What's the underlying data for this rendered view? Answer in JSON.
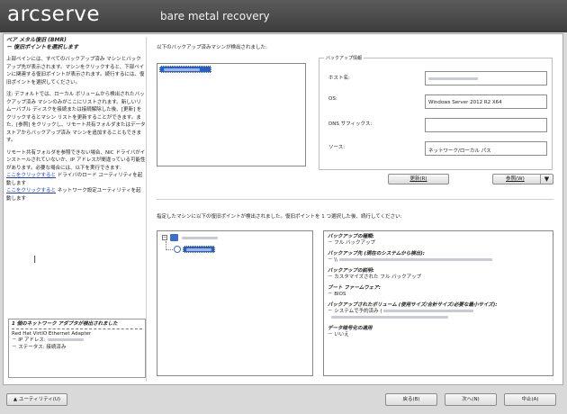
{
  "header": {
    "logo": "arcserve",
    "title": "bare metal recovery"
  },
  "left": {
    "title_line1": "ベア メタル復旧 (BMR)",
    "title_line2": "－ 復旧ポイントを選択します",
    "p1": "上部ペインには、すべてのバックアップ済み マシンとバックアップ先が表示されます。マシンをクリックすると、下部ペインに関連する復旧ポイントが表示されます。続行するには、復旧ポイントを選択してください。",
    "p2": "注: デフォルトでは、ローカル ボリュームから検出されたバックアップ済み マシンのみがここにリストされます。新しいリムーバブル ディスクを接続または接続解除した後、[更新] をクリックするとマシン リストを更新することができます。また、[参照] をクリックし、リモート共有フォルダまたはデータ ストアからバックアップ済み マシンを追加することもできます。",
    "p3": "リモート共有フォルダを参照できない場合、NIC ドライバがインストールされていないか、IP アドレスが間違っている可能性があります。必要な場合には、以下を実行できます:",
    "link1": "ここをクリックすると",
    "link1_rest": " ドライバのロード ユーティリティを起動します",
    "link2": "ここをクリックすると",
    "link2_rest": " ネットワーク設定ユーティリティを起動します",
    "net_title": "1 個のネットワーク アダプタが検出されました",
    "net_adapter": "Red Hat VirtIO Ethernet Adapter",
    "net_ip_label": "－ IP アドレス:",
    "net_status": "－ ステータス: 接続済み"
  },
  "top": {
    "detected_label": "以下のバックアップ済みマシンが検出されました:",
    "info_legend": "バックアップ情報",
    "host_label": "ホスト名:",
    "os_label": "OS:",
    "os_value": "Windows Server 2012 R2 X64",
    "dns_label": "DNS サフィックス:",
    "source_label": "ソース:",
    "source_value": "ネットワーク/ローカル パス",
    "refresh_btn": "更新(R)",
    "browse_btn": "参照(W)"
  },
  "bottom": {
    "rp_label": "指定したマシンに以下の復旧ポイントが検出されました。復旧ポイントを 1 つ選択した後、続行してください:",
    "d1_h": "バックアップの種類:",
    "d1_v": "－ フル バックアップ",
    "d2_h": "バックアップ先 (現在のシステムから検出):",
    "d2_v": "－ \\\\",
    "d3_h": "バックアップの説明:",
    "d3_v": "－ カスタマイズされた フル バックアップ",
    "d4_h": "ブート ファームウェア:",
    "d4_v": "－ BIOS",
    "d5_h": "バックアップされたボリューム (使用サイズ/合計サイズ/必要な最小サイズ):",
    "d5_v": "－ システムで予約済み (",
    "d6_h": "データ暗号化の適用",
    "d6_v": "－ いいえ"
  },
  "footer": {
    "utilities": "ユーティリティ(U)",
    "back": "戻る(B)",
    "next": "次へ(N)",
    "abort": "中止(A)"
  }
}
